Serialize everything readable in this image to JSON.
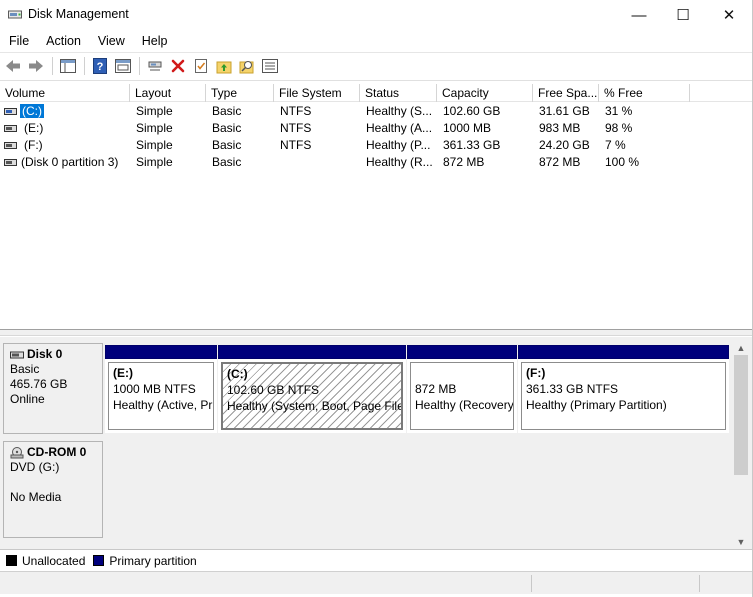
{
  "window": {
    "title": "Disk Management",
    "minimize_glyph": "—",
    "maximize_glyph": "☐",
    "close_glyph": "✕"
  },
  "menu": [
    "File",
    "Action",
    "View",
    "Help"
  ],
  "toolbar": {
    "icons": [
      "back-icon",
      "forward-icon",
      "console-tree-icon",
      "help-icon",
      "console-view-icon",
      "connect-icon",
      "delete-icon",
      "properties-icon",
      "up-folder-icon",
      "search-icon",
      "list-view-icon"
    ]
  },
  "volume_list": {
    "columns": [
      "Volume",
      "Layout",
      "Type",
      "File System",
      "Status",
      "Capacity",
      "Free Spa...",
      "% Free"
    ],
    "rows": [
      {
        "volume": "(C:)",
        "layout": "Simple",
        "type": "Basic",
        "fs": "NTFS",
        "status": "Healthy (S...",
        "capacity": "102.60 GB",
        "free": "31.61 GB",
        "pct": "31 %",
        "selected": true
      },
      {
        "volume": "(E:)",
        "layout": "Simple",
        "type": "Basic",
        "fs": "NTFS",
        "status": "Healthy (A...",
        "capacity": "1000 MB",
        "free": "983 MB",
        "pct": "98 %",
        "selected": false
      },
      {
        "volume": "(F:)",
        "layout": "Simple",
        "type": "Basic",
        "fs": "NTFS",
        "status": "Healthy (P...",
        "capacity": "361.33 GB",
        "free": "24.20 GB",
        "pct": "7 %",
        "selected": false
      },
      {
        "volume": "(Disk 0 partition 3)",
        "layout": "Simple",
        "type": "Basic",
        "fs": "",
        "status": "Healthy (R...",
        "capacity": "872 MB",
        "free": "872 MB",
        "pct": "100 %",
        "selected": false
      }
    ]
  },
  "disks": [
    {
      "name": "Disk 0",
      "type": "Basic",
      "size": "465.76 GB",
      "state": "Online",
      "partitions": [
        {
          "name": "(E:)",
          "size": "1000 MB NTFS",
          "status": "Healthy (Active, Primary Partition)"
        },
        {
          "name": "(C:)",
          "size": "102.60 GB NTFS",
          "status": "Healthy (System, Boot, Page File, Active, Crash Dump, Primary Partition)"
        },
        {
          "name": "",
          "size": "872 MB",
          "status": "Healthy (Recovery Partition)"
        },
        {
          "name": "(F:)",
          "size": "361.33 GB NTFS",
          "status": "Healthy (Primary Partition)"
        }
      ]
    },
    {
      "name": "CD-ROM 0",
      "type": "DVD (G:)",
      "state": "No Media"
    }
  ],
  "legend": [
    {
      "label": "Unallocated",
      "color": "#000000"
    },
    {
      "label": "Primary partition",
      "color": "#00007c"
    }
  ],
  "colors": {
    "selection": "#0078d7",
    "partition_bar": "#00007c"
  }
}
